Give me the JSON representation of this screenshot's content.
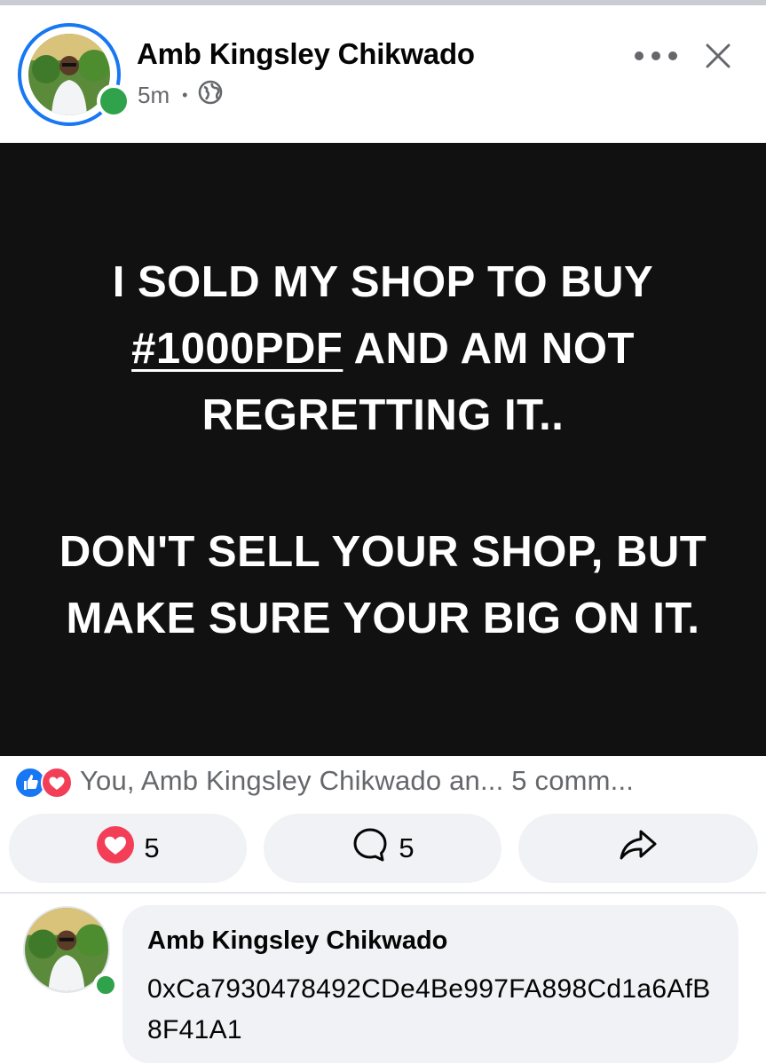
{
  "post": {
    "author": "Amb Kingsley Chikwado",
    "time": "5m",
    "separator": "•",
    "privacy_icon": "globe-icon",
    "text_lines": [
      "I SOLD MY SHOP TO BUY",
      "#1000PDF",
      " AND AM NOT",
      "REGRETTING IT..",
      "DON'T SELL YOUR SHOP, BUT",
      "MAKE SURE YOUR BIG ON IT."
    ],
    "background_color": "#111111"
  },
  "reactions": {
    "icons": [
      "like-icon",
      "love-icon"
    ],
    "summary": "You, Amb Kingsley Chikwado an... 5 comm..."
  },
  "actions": {
    "love_count": "5",
    "comment_count": "5",
    "icons": [
      "love-icon",
      "comment-icon",
      "share-icon"
    ]
  },
  "comment": {
    "author": "Amb Kingsley Chikwado",
    "text": "0xCa7930478492CDe4Be997FA898Cd1a6AfB8F41A1"
  },
  "colors": {
    "accent": "#1877f2",
    "online": "#31a24c",
    "love": "#f33e58",
    "muted": "#65676b"
  }
}
